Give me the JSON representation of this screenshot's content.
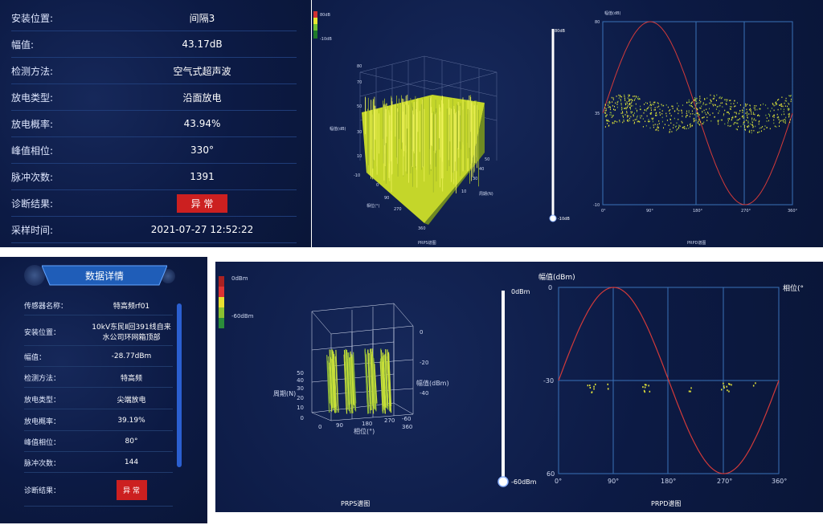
{
  "top_panel": {
    "rows": [
      {
        "label": "安装位置:",
        "value": "间隔3"
      },
      {
        "label": "幅值:",
        "value": "43.17dB"
      },
      {
        "label": "检测方法:",
        "value": "空气式超声波"
      },
      {
        "label": "放电类型:",
        "value": "沿面放电"
      },
      {
        "label": "放电概率:",
        "value": "43.94%"
      },
      {
        "label": "峰值相位:",
        "value": "330°"
      },
      {
        "label": "脉冲次数:",
        "value": "1391"
      },
      {
        "label": "诊断结果:",
        "value": "异 常",
        "badge": true
      },
      {
        "label": "采样时间:",
        "value": "2021-07-27 12:52:22"
      }
    ],
    "prps": {
      "legend_top": "80dB",
      "legend_bottom": "-10dB",
      "axis_labels": [
        "幅值(dB)",
        "相位(°)",
        "周期(N)"
      ],
      "z_ticks": [
        "80",
        "70",
        "50",
        "30",
        "10",
        "-10"
      ],
      "x_ticks": [
        "0",
        "90",
        "180",
        "270",
        "360"
      ],
      "y_ticks": [
        "0",
        "10",
        "30",
        "40",
        "50"
      ],
      "caption": "PRPS谱图"
    },
    "prpd": {
      "slider_top": "80dB",
      "slider_bottom": "-10dB",
      "ylabel": "幅值(dB)",
      "y_ticks": [
        "80",
        "35",
        "-10"
      ],
      "x_ticks": [
        "0°",
        "90°",
        "180°",
        "270°",
        "360°"
      ],
      "caption": "PRPD谱图"
    }
  },
  "bottom_panel": {
    "title": "数据详情",
    "rows": [
      {
        "label": "传感器名称：",
        "value": "特高频rf01"
      },
      {
        "label": "安装位置：",
        "value": "10kV东民Ⅱ回391线自来水公司环网箱顶部"
      },
      {
        "label": "幅值：",
        "value": "-28.77dBm"
      },
      {
        "label": "检测方法：",
        "value": "特高频"
      },
      {
        "label": "放电类型：",
        "value": "尖端放电"
      },
      {
        "label": "放电概率：",
        "value": "39.19%"
      },
      {
        "label": "峰值相位：",
        "value": "80°"
      },
      {
        "label": "脉冲次数：",
        "value": "144"
      },
      {
        "label": "诊断结果：",
        "value": "异 常",
        "badge": true
      }
    ],
    "prps": {
      "legend_top": "0dBm",
      "legend_bottom": "-60dBm",
      "zlabel": "幅值(dBm)",
      "ylabel": "周期(N)",
      "xlabel": "相位(°)",
      "z_ticks": [
        "0",
        "-20",
        "-40",
        "-60"
      ],
      "y_ticks": [
        "50",
        "40",
        "30",
        "20",
        "10",
        "0"
      ],
      "x_ticks": [
        "0",
        "90",
        "180",
        "270",
        "360"
      ],
      "caption": "PRPS谱图"
    },
    "prpd": {
      "slider_top": "0dBm",
      "slider_bottom": "-60dBm",
      "ylabel": "幅值(dBm)",
      "ylabel_right": "相位(°",
      "y_ticks": [
        "0",
        "-30",
        "60"
      ],
      "x_ticks": [
        "0°",
        "90°",
        "180°",
        "270°",
        "360°"
      ],
      "caption": "PRPD谱图"
    }
  },
  "colors": {
    "bg": "#0c1a44",
    "alarm": "#cc2020",
    "trace": "#d33a3a",
    "points": "#e6e63a",
    "accent": "#2e64c8"
  }
}
